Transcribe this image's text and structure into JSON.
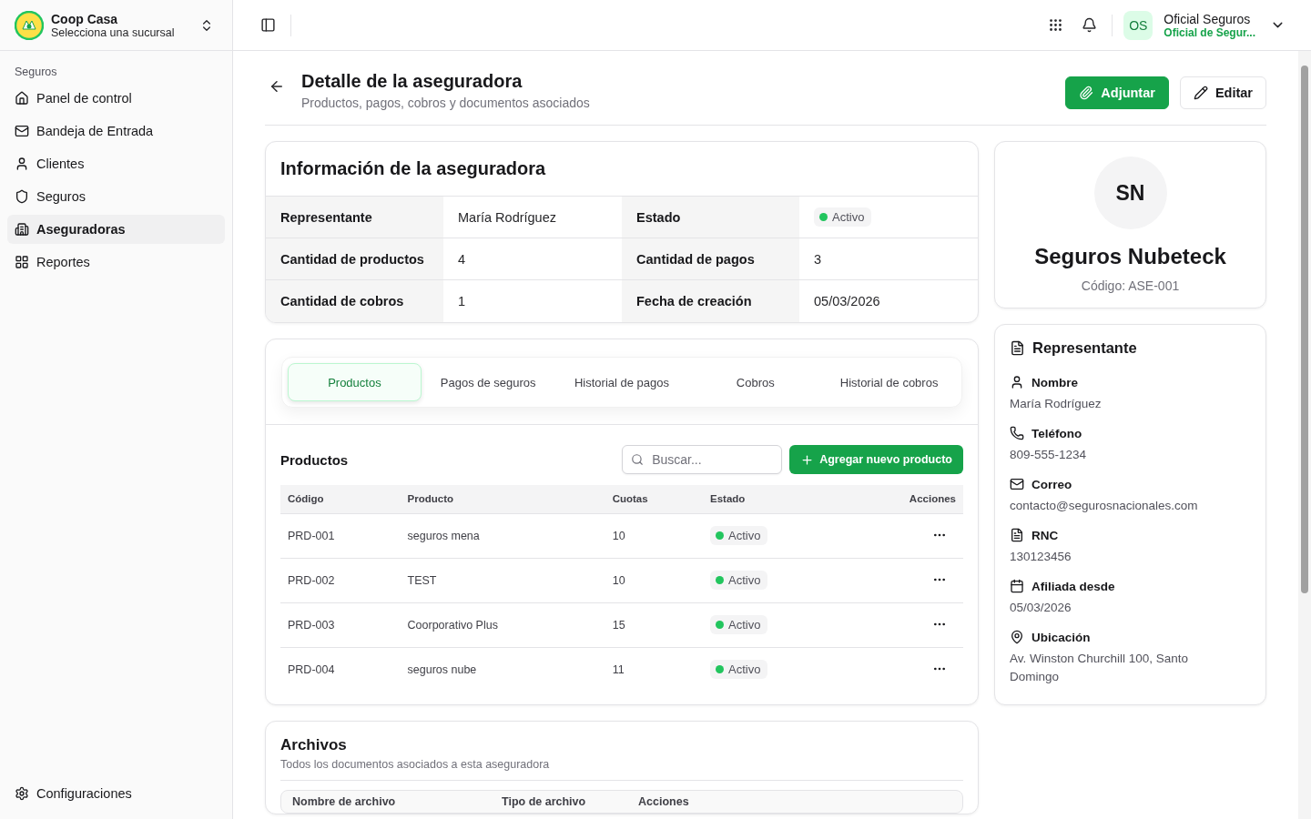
{
  "sidebar": {
    "org": {
      "name": "Coop Casa",
      "subtitle": "Selecciona una sucursal"
    },
    "section": "Seguros",
    "items": [
      {
        "label": "Panel de control",
        "selected": false
      },
      {
        "label": "Bandeja de Entrada",
        "selected": false
      },
      {
        "label": "Clientes",
        "selected": false
      },
      {
        "label": "Seguros",
        "selected": false
      },
      {
        "label": "Aseguradoras",
        "selected": true
      },
      {
        "label": "Reportes",
        "selected": false
      }
    ],
    "footer": "Configuraciones"
  },
  "topbar": {
    "user": {
      "initials": "OS",
      "name": "Oficial Seguros",
      "role": "Oficial de Segur..."
    }
  },
  "page": {
    "title": "Detalle de la aseguradora",
    "subtitle": "Productos, pagos, cobros y documentos asociados",
    "actions": [
      {
        "label": "Adjuntar",
        "kind": "primary"
      },
      {
        "label": "Editar",
        "kind": "outline"
      }
    ]
  },
  "info": {
    "title": "Información de la aseguradora",
    "rows": [
      [
        {
          "label": "Representante",
          "value": "María Rodríguez",
          "kind": "text"
        },
        {
          "label": "Estado",
          "value": "Activo",
          "kind": "status"
        }
      ],
      [
        {
          "label": "Cantidad de productos",
          "value": "4",
          "kind": "text"
        },
        {
          "label": "Cantidad de pagos",
          "value": "3",
          "kind": "text"
        }
      ],
      [
        {
          "label": "Cantidad de cobros",
          "value": "1",
          "kind": "text"
        },
        {
          "label": "Fecha de creación",
          "value": "05/03/2026",
          "kind": "text"
        }
      ]
    ]
  },
  "tabs": [
    {
      "label": "Productos",
      "selected": true
    },
    {
      "label": "Pagos de seguros",
      "selected": false
    },
    {
      "label": "Historial de pagos",
      "selected": false
    },
    {
      "label": "Cobros",
      "selected": false
    },
    {
      "label": "Historial de cobros",
      "selected": false
    }
  ],
  "products": {
    "title": "Productos",
    "search": {
      "placeholder": "Buscar..."
    },
    "add_button": "Agregar nuevo producto",
    "columns": [
      "Código",
      "Producto",
      "Cuotas",
      "Estado",
      "Acciones"
    ],
    "rows": [
      {
        "code": "PRD-001",
        "product": "seguros mena",
        "installments": "10",
        "status": "Activo"
      },
      {
        "code": "PRD-002",
        "product": "TEST",
        "installments": "10",
        "status": "Activo"
      },
      {
        "code": "PRD-003",
        "product": "Coorporativo Plus",
        "installments": "15",
        "status": "Activo"
      },
      {
        "code": "PRD-004",
        "product": "seguros nube",
        "installments": "11",
        "status": "Activo"
      }
    ]
  },
  "files": {
    "title": "Archivos",
    "subtitle": "Todos los documentos asociados a esta aseguradora",
    "columns": [
      "Nombre de archivo",
      "Tipo de archivo",
      "Acciones"
    ]
  },
  "profile": {
    "initials": "SN",
    "name": "Seguros Nubeteck",
    "code": "Código: ASE-001"
  },
  "representative": {
    "title": "Representante",
    "fields": [
      {
        "label": "Nombre",
        "value": "María Rodríguez"
      },
      {
        "label": "Teléfono",
        "value": "809-555-1234"
      },
      {
        "label": "Correo",
        "value": "contacto@segurosnacionales.com"
      },
      {
        "label": "RNC",
        "value": "130123456"
      },
      {
        "label": "Afiliada desde",
        "value": "05/03/2026"
      },
      {
        "label": "Ubicación",
        "value": "Av. Winston Churchill 100, Santo Domingo"
      }
    ]
  }
}
